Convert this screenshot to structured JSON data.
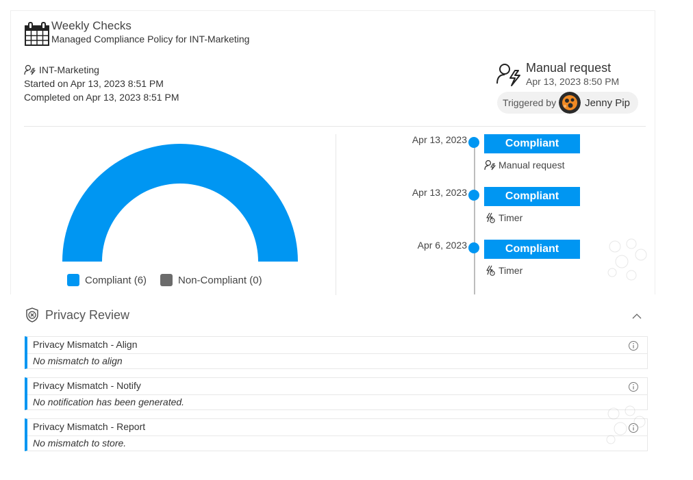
{
  "header": {
    "policy_type": "Weekly Checks",
    "policy_name": "Managed Compliance Policy for INT-Marketing",
    "icon": "calendar-icon"
  },
  "meta": {
    "scope": "INT-Marketing",
    "started": "Started on Apr 13, 2023 8:51 PM",
    "completed": "Completed on Apr 13, 2023 8:51 PM"
  },
  "trigger": {
    "type": "Manual request",
    "date": "Apr 13, 2023 8:50 PM",
    "triggered_by_label": "Triggered by",
    "user_name": "Jenny Pip"
  },
  "chart_data": {
    "type": "pie",
    "variant": "half-donut",
    "categories": [
      "Compliant (6)",
      "Non-Compliant (0)"
    ],
    "values": [
      6,
      0
    ],
    "colors": [
      "#0096f2",
      "#6b6b6b"
    ],
    "legend_position": "bottom"
  },
  "timeline": [
    {
      "date": "Apr 13, 2023",
      "status": "Compliant",
      "trigger": "Manual request",
      "trigger_icon": "user-bolt-icon"
    },
    {
      "date": "Apr 13, 2023",
      "status": "Compliant",
      "trigger": "Timer",
      "trigger_icon": "timer-bolt-icon"
    },
    {
      "date": "Apr 6, 2023",
      "status": "Compliant",
      "trigger": "Timer",
      "trigger_icon": "timer-bolt-icon"
    }
  ],
  "privacy_review": {
    "title": "Privacy Review",
    "items": [
      {
        "title": "Privacy Mismatch - Align",
        "description": "No mismatch to align"
      },
      {
        "title": "Privacy Mismatch - Notify",
        "description": "No notification has been generated."
      },
      {
        "title": "Privacy Mismatch - Report",
        "description": "No mismatch to store."
      }
    ]
  },
  "colors": {
    "accent": "#0096f2",
    "non_compliant": "#6b6b6b",
    "border": "#e8e8e8"
  }
}
